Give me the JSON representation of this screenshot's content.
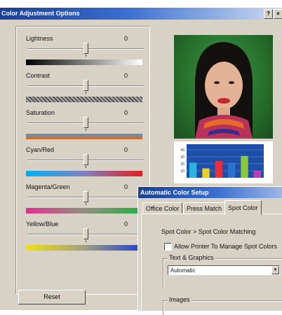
{
  "main_window": {
    "title": "Color Adjustment Options",
    "help_button": "?",
    "close_button": "×",
    "reset_label": "Reset"
  },
  "sliders": [
    {
      "label": "Lightness",
      "value": "0",
      "gradient": [
        "#000000",
        "#ffffff"
      ]
    },
    {
      "label": "Contrast",
      "value": "0",
      "gradient": [
        "#888888",
        "#333333"
      ]
    },
    {
      "label": "Saturation",
      "value": "0",
      "gradient": [
        "#808080",
        "#e07020"
      ]
    },
    {
      "label": "Cyan/Red",
      "value": "0",
      "gradient": [
        "#00b0f0",
        "#e02020"
      ]
    },
    {
      "label": "Magenta/Green",
      "value": "0",
      "gradient": [
        "#e0308f",
        "#20b040"
      ]
    },
    {
      "label": "Yellow/Blue",
      "value": "0",
      "gradient": [
        "#f0e010",
        "#2040d0"
      ]
    }
  ],
  "preview_chart": {
    "y_ticks": [
      "40",
      "30",
      "20",
      "10"
    ],
    "bar_colors": [
      "#28b6e0",
      "#ecd020",
      "#e83040",
      "#2c70d0",
      "#8cc838",
      "#c03ab8"
    ],
    "bar_values": [
      0.45,
      0.28,
      0.5,
      0.45,
      0.65,
      0.22
    ]
  },
  "popup": {
    "title": "Automatic Color Setup",
    "tabs": [
      "Office Color",
      "Press Match",
      "Spot Color"
    ],
    "active_tab": "Spot Color",
    "section_title": "Spot Color > Spot Color Matching",
    "checkbox_label": "Allow Printer To Manage Spot Colors",
    "checkbox_checked": false,
    "text_graphics_label": "Text & Graphics",
    "text_graphics_value": "Automatic",
    "images_label": "Images"
  }
}
